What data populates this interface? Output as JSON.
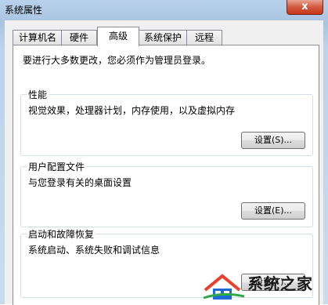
{
  "window": {
    "title": "系统属性",
    "close_glyph": "x"
  },
  "tabs": [
    {
      "label": "计算机名"
    },
    {
      "label": "硬件"
    },
    {
      "label": "高级",
      "active": true
    },
    {
      "label": "系统保护"
    },
    {
      "label": "远程"
    }
  ],
  "panel": {
    "admin_note": "要进行大多数更改，您必须作为管理员登录。",
    "groups": [
      {
        "title": "性能",
        "desc": "视觉效果，处理器计划，内存使用，以及虚拟内存",
        "button": "设置(S)..."
      },
      {
        "title": "用户配置文件",
        "desc": "与您登录有关的桌面设置",
        "button": "设置(E)..."
      },
      {
        "title": "启动和故障恢复",
        "desc": "系统启动、系统失败和调试信息",
        "button": "设置(T)..."
      }
    ]
  },
  "watermark": {
    "text": "系统之家",
    "icon": "house-logo-icon",
    "colors": [
      "#1e6ad6",
      "#e8402a",
      "#2ea84b"
    ]
  }
}
